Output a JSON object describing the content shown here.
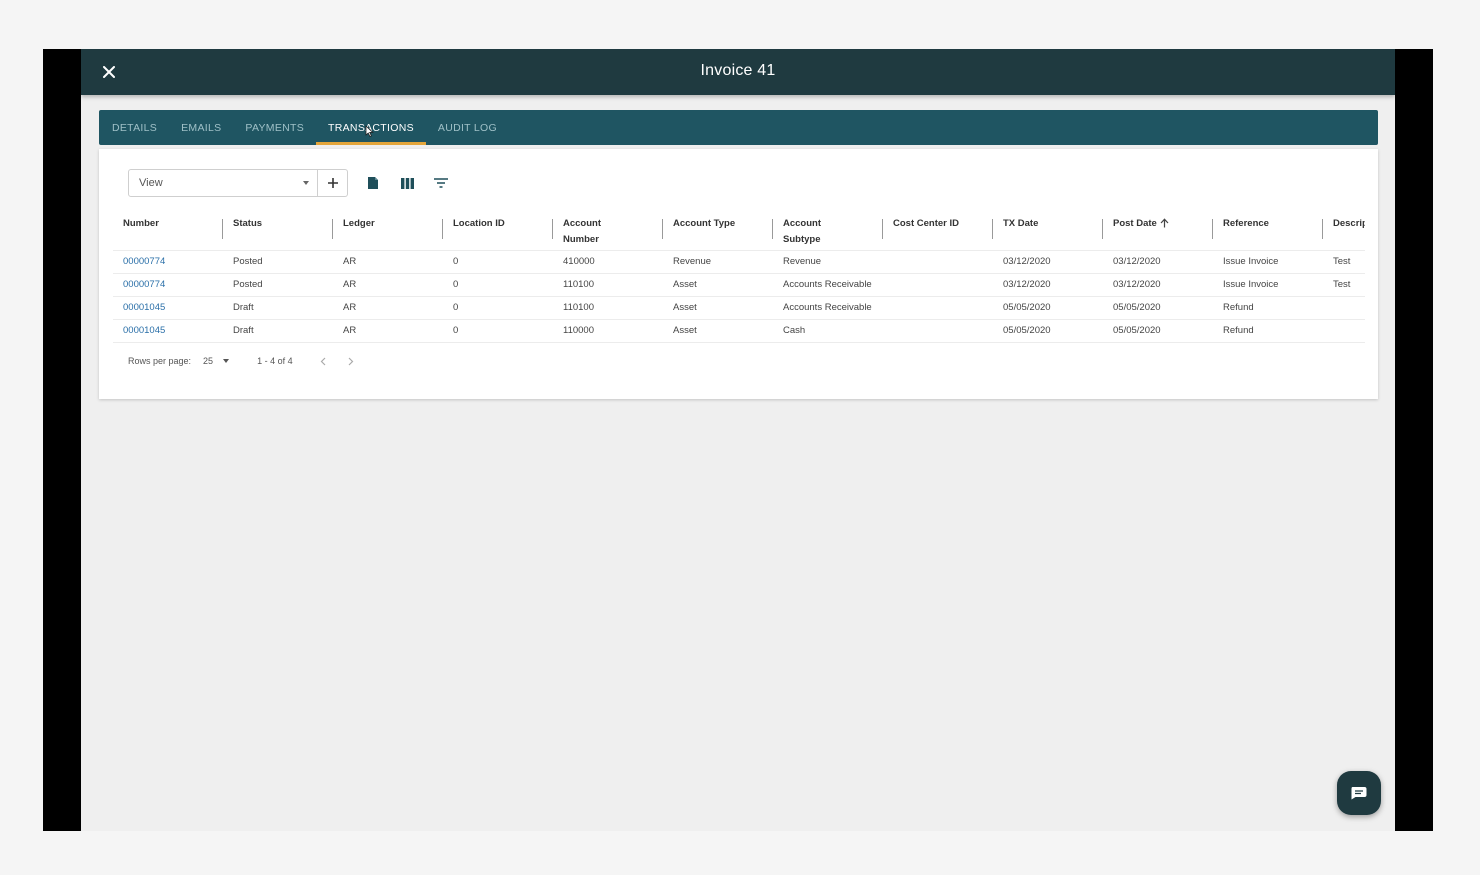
{
  "header": {
    "title": "Invoice 41"
  },
  "tabs": [
    {
      "label": "DETAILS"
    },
    {
      "label": "EMAILS"
    },
    {
      "label": "PAYMENTS"
    },
    {
      "label": "TRANSACTIONS",
      "active": true
    },
    {
      "label": "AUDIT LOG"
    }
  ],
  "toolbar": {
    "view_value": "View",
    "icons": [
      "add-icon",
      "document-icon",
      "columns-icon",
      "filter-icon"
    ]
  },
  "table": {
    "columns": [
      {
        "line1": "Number",
        "line2": ""
      },
      {
        "line1": "Status",
        "line2": ""
      },
      {
        "line1": "Ledger",
        "line2": ""
      },
      {
        "line1": "Location ID",
        "line2": ""
      },
      {
        "line1": "Account",
        "line2": "Number"
      },
      {
        "line1": "Account Type",
        "line2": ""
      },
      {
        "line1": "Account",
        "line2": "Subtype"
      },
      {
        "line1": "Cost Center ID",
        "line2": ""
      },
      {
        "line1": "TX Date",
        "line2": ""
      },
      {
        "line1": "Post Date",
        "line2": "",
        "sorted": "asc"
      },
      {
        "line1": "Reference",
        "line2": ""
      },
      {
        "line1": "Descrip",
        "line2": ""
      }
    ],
    "rows": [
      [
        "00000774",
        "Posted",
        "AR",
        "0",
        "410000",
        "Revenue",
        "Revenue",
        "",
        "03/12/2020",
        "03/12/2020",
        "Issue Invoice",
        "Test"
      ],
      [
        "00000774",
        "Posted",
        "AR",
        "0",
        "110100",
        "Asset",
        "Accounts Receivable",
        "",
        "03/12/2020",
        "03/12/2020",
        "Issue Invoice",
        "Test"
      ],
      [
        "00001045",
        "Draft",
        "AR",
        "0",
        "110100",
        "Asset",
        "Accounts Receivable",
        "",
        "05/05/2020",
        "05/05/2020",
        "Refund",
        ""
      ],
      [
        "00001045",
        "Draft",
        "AR",
        "0",
        "110000",
        "Asset",
        "Cash",
        "",
        "05/05/2020",
        "05/05/2020",
        "Refund",
        ""
      ]
    ]
  },
  "pagination": {
    "rows_per_page_label": "Rows per page:",
    "rows_per_page_value": "25",
    "range_text": "1 - 4 of 4"
  },
  "colors": {
    "header_bg": "#1f3a40",
    "tab_bar_bg": "#1f5562",
    "active_tab_indicator": "#e3a53a",
    "link": "#2a6fa8"
  }
}
